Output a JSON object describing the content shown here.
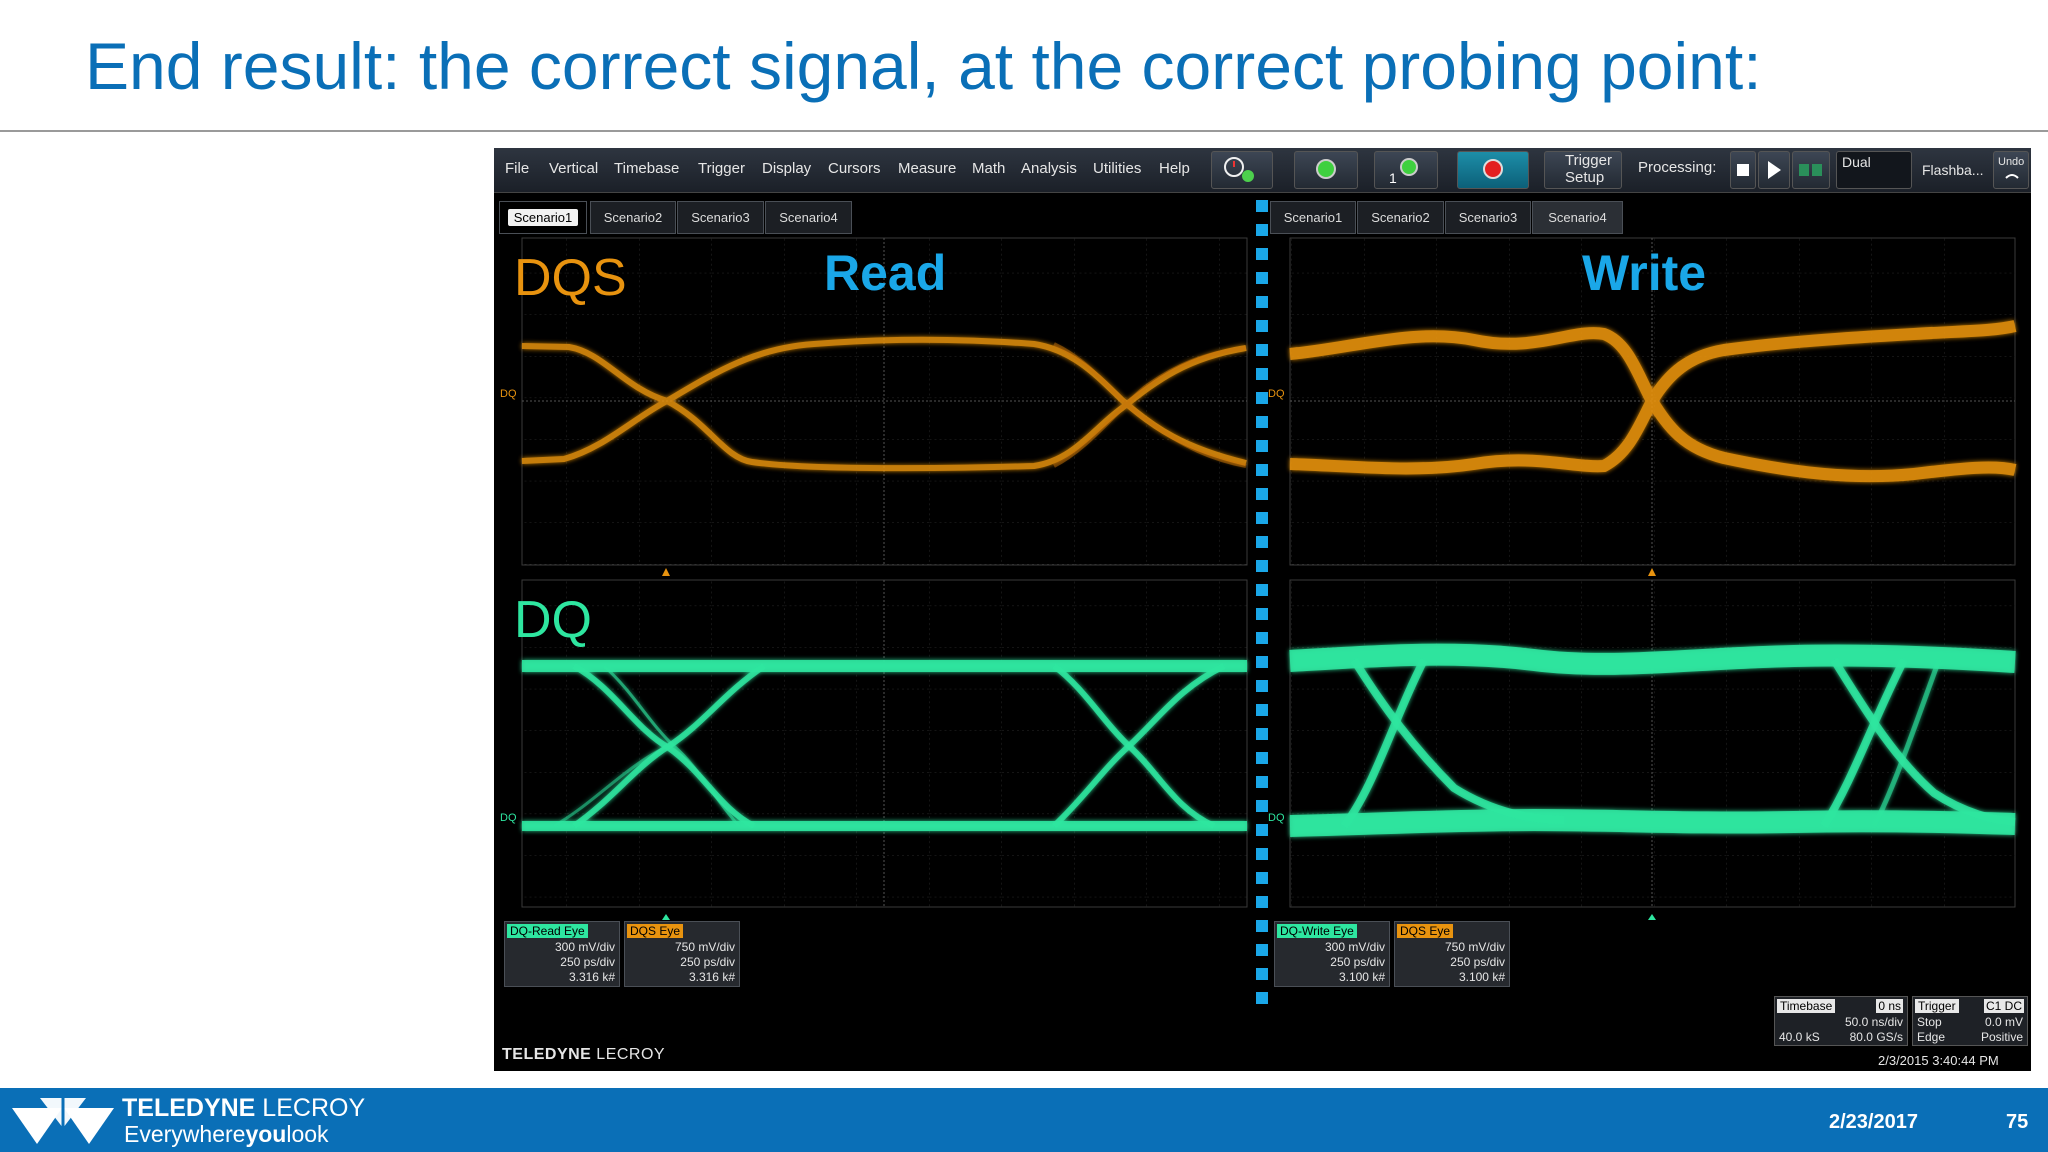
{
  "slide": {
    "title": "End result: the correct signal, at the correct probing point:"
  },
  "menu": {
    "items": [
      "File",
      "Vertical",
      "Timebase",
      "Trigger",
      "Display",
      "Cursors",
      "Measure",
      "Math",
      "Analysis",
      "Utilities",
      "Help"
    ],
    "trigger_setup_line1": "Trigger",
    "trigger_setup_line2": "Setup",
    "processing_label": "Processing:",
    "dual_label": "Dual",
    "flashback_label": "Flashba...",
    "undo_label": "Undo"
  },
  "tabs_left": [
    "Scenario1",
    "Scenario2",
    "Scenario3",
    "Scenario4"
  ],
  "tabs_right": [
    "Scenario1",
    "Scenario2",
    "Scenario3",
    "Scenario4"
  ],
  "labels": {
    "dqs": "DQS",
    "dq": "DQ",
    "read": "Read",
    "write": "Write",
    "axis_dq": "DQ"
  },
  "measurements_left": [
    {
      "name": "DQ-Read Eye",
      "v": "300 mV/div",
      "t": "250 ps/div",
      "n": "3.316 k#"
    },
    {
      "name": "DQS Eye",
      "v": "750 mV/div",
      "t": "250 ps/div",
      "n": "3.316 k#"
    }
  ],
  "measurements_right": [
    {
      "name": "DQ-Write Eye",
      "v": "300 mV/div",
      "t": "250 ps/div",
      "n": "3.100 k#"
    },
    {
      "name": "DQS Eye",
      "v": "750 mV/div",
      "t": "250 ps/div",
      "n": "3.100 k#"
    }
  ],
  "timebase": {
    "label": "Timebase",
    "offset": "0 ns",
    "per_div": "50.0 ns/div",
    "samples": "40.0 kS",
    "rate": "80.0 GS/s"
  },
  "trigger": {
    "label": "Trigger",
    "channels": "C1 DC",
    "mode": "Stop",
    "level": "0.0 mV",
    "type": "Edge",
    "slope": "Positive"
  },
  "scope_timestamp": "2/3/2015 3:40:44 PM",
  "scope_brand": {
    "bold": "TELEDYNE",
    "thin": " LECROY"
  },
  "footer": {
    "brand_bold": "TELEDYNE",
    "brand_thin": " LECROY",
    "tagline_pre": "Everywhere",
    "tagline_bold": "you",
    "tagline_post": "look",
    "date": "2/23/2017",
    "page": "75"
  },
  "colors": {
    "title_blue": "#0a6fb7",
    "dqs_orange": "#e8930f",
    "dq_green": "#2ee6a0",
    "accent_cyan": "#1aa7e8"
  }
}
